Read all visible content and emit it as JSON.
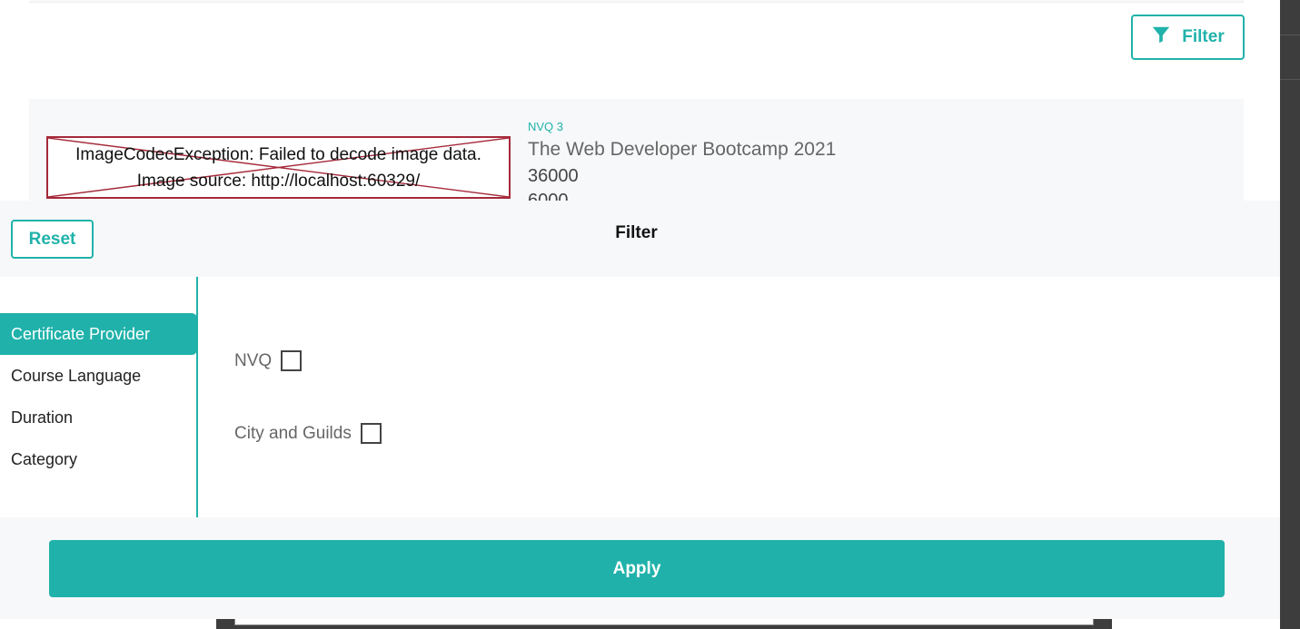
{
  "toolbar": {
    "filter_label": "Filter",
    "filter_icon": "funnel-icon"
  },
  "course": {
    "image_error_line1": "ImageCodecException: Failed to decode image data.",
    "image_error_line2": "Image source: http://localhost:60329/",
    "tag": "NVQ 3",
    "title": "The Web Developer Bootcamp 2021",
    "price": "36000",
    "price_secondary": "6000"
  },
  "modal": {
    "reset_label": "Reset",
    "title": "Filter",
    "tabs": [
      {
        "label": "Certificate Provider",
        "active": true
      },
      {
        "label": "Course Language",
        "active": false
      },
      {
        "label": "Duration",
        "active": false
      },
      {
        "label": "Category",
        "active": false
      }
    ],
    "options": [
      {
        "label": "NVQ",
        "checked": false
      },
      {
        "label": "City and Guilds",
        "checked": false
      }
    ],
    "apply_label": "Apply"
  },
  "colors": {
    "accent": "#20b2aa",
    "panel_bg": "#f7f8fa",
    "error_border": "#a52a3a"
  }
}
